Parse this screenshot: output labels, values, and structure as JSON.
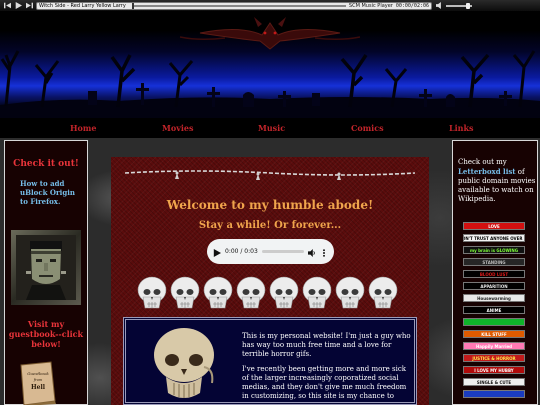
{
  "player": {
    "track": "Witch Side - Red Larry Yellow Larry",
    "name": "SCM Music Player",
    "time": "00:00/02:06",
    "progress": 0.0
  },
  "nav": {
    "home": "Home",
    "movies": "Movies",
    "music": "Music",
    "comics": "Comics",
    "links": "Links"
  },
  "left": {
    "check_it": "Check it out!",
    "ublock": "How to add uBlock Origin to Firefox.",
    "guestbook": "Visit my guestbook--click below!",
    "book_title": "Guestbook from Hell"
  },
  "center": {
    "welcome": "Welcome to my humble abode!",
    "stay": "Stay a while! Or forever...",
    "audio_time": "0:00 / 0:03",
    "audio_progress": 0.0,
    "intro_p1": "This is my personal website! I'm just a guy who has way too much free time and a love for terrible horror gifs.",
    "intro_p2": "I've recently been getting more and more sick of the larger increasingly coporatized social medias, and they don't give me much freedom in customizing, so this site is my chance to"
  },
  "right": {
    "pre": "Check out my ",
    "link": "Letterboxd list",
    "post": " of public domain movies available to watch on Wikipedia.",
    "badges": [
      {
        "text": "LOVE",
        "bg": "#d21010",
        "fg": "#ffffff"
      },
      {
        "text": "DON'T TRUST ANYONE OVER 30",
        "bg": "#f2f2f2",
        "fg": "#000000"
      },
      {
        "text": "my brain is GLOWING",
        "bg": "#101010",
        "fg": "#7fff3a"
      },
      {
        "text": "STANDING",
        "bg": "#262626",
        "fg": "#bbbbbb"
      },
      {
        "text": "BLOOD LUST",
        "bg": "#000000",
        "fg": "#e01818"
      },
      {
        "text": "APPARITION",
        "bg": "#000000",
        "fg": "#e8e8e8"
      },
      {
        "text": "Housewarming",
        "bg": "#e8e8e8",
        "fg": "#222222"
      },
      {
        "text": "ANIME",
        "bg": "#000000",
        "fg": "#ffffff"
      },
      {
        "text": "",
        "bg": "#0fb32a",
        "fg": "#ffffff"
      },
      {
        "text": "KILL STUFF",
        "bg": "#e05a00",
        "fg": "#ffffff"
      },
      {
        "text": "Happily Married",
        "bg": "#ff7ab5",
        "fg": "#ffffff"
      },
      {
        "text": "JUSTICE & HORROR",
        "bg": "#c21a1a",
        "fg": "#ffe94a"
      },
      {
        "text": "I LOVE MY HUBBY",
        "bg": "#b00a0a",
        "fg": "#ffffff"
      },
      {
        "text": "SINGLE & CUTE",
        "bg": "#efefef",
        "fg": "#111111"
      },
      {
        "text": "",
        "bg": "#1a3cc0",
        "fg": "#ffffff"
      }
    ]
  },
  "colors": {
    "accent_red": "#e8343a",
    "link_blue": "#76bde8",
    "heading_orange": "#f0a54c",
    "panel_red": "#5a0c0c",
    "intro_navy": "#040434"
  }
}
